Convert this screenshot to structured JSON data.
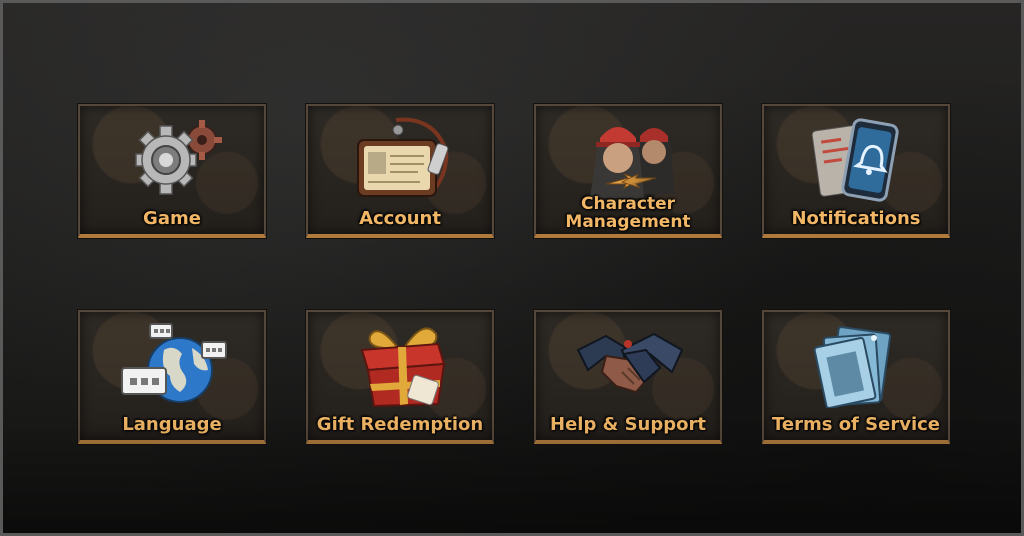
{
  "settings": {
    "tiles": [
      {
        "label": "Game",
        "icon": "gear-icon"
      },
      {
        "label": "Account",
        "icon": "id-badge-icon"
      },
      {
        "label": "Character\nManagement",
        "icon": "characters-swap-icon"
      },
      {
        "label": "Notifications",
        "icon": "phone-bell-icon"
      },
      {
        "label": "Language",
        "icon": "globe-chat-icon"
      },
      {
        "label": "Gift Redemption",
        "icon": "gift-box-icon"
      },
      {
        "label": "Help & Support",
        "icon": "handshake-icon"
      },
      {
        "label": "Terms of Service",
        "icon": "documents-icon"
      }
    ]
  },
  "colors": {
    "label": "#f2b766",
    "tile_border": "#55483a",
    "tile_accent": "#b07a3c",
    "background": "#1b1b1b"
  }
}
